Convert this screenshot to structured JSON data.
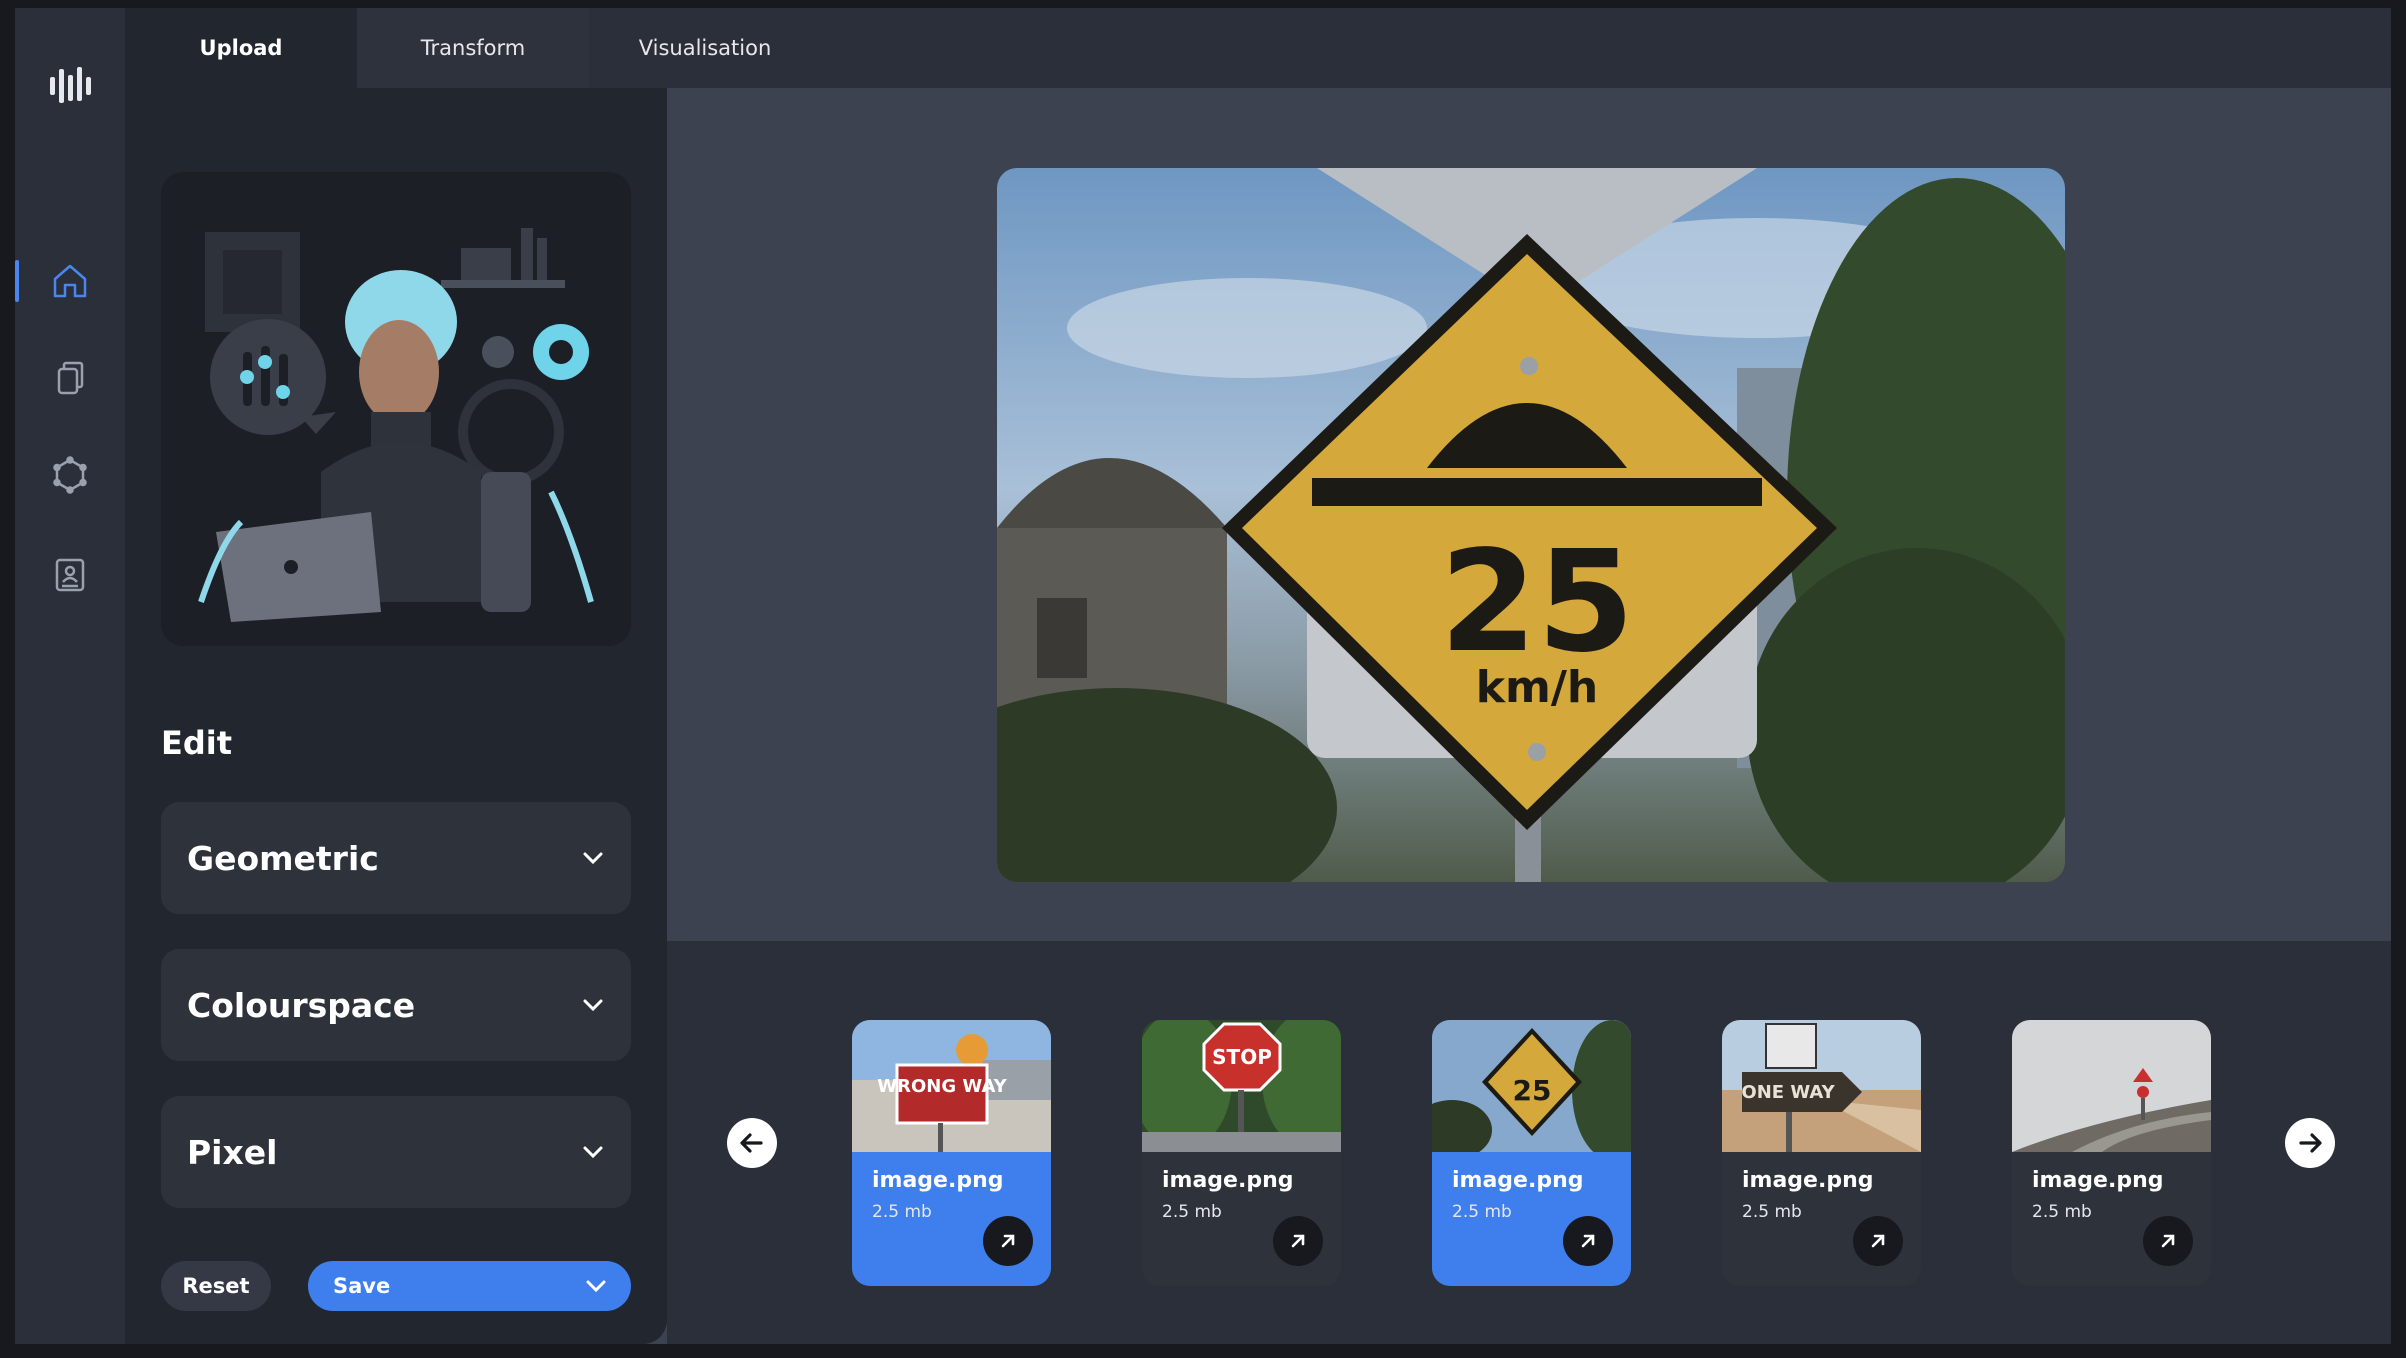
{
  "tabs": [
    {
      "label": "Upload"
    },
    {
      "label": "Transform"
    },
    {
      "label": "Visualisation"
    }
  ],
  "rail": {
    "items": [
      {
        "icon": "home-icon",
        "active": true
      },
      {
        "icon": "copy-icon"
      },
      {
        "icon": "hexagon-icon"
      },
      {
        "icon": "report-icon"
      }
    ]
  },
  "panel": {
    "edit_title": "Edit",
    "sections": [
      {
        "label": "Geometric"
      },
      {
        "label": "Colourspace"
      },
      {
        "label": "Pixel"
      }
    ],
    "reset_label": "Reset",
    "save_label": "Save"
  },
  "preview": {
    "sign_number": "25",
    "sign_unit": "km/h"
  },
  "gallery": [
    {
      "name": "image.png",
      "size": "2.5 mb",
      "selected": true,
      "sign": "WRONG WAY"
    },
    {
      "name": "image.png",
      "size": "2.5 mb",
      "selected": false,
      "sign": "STOP"
    },
    {
      "name": "image.png",
      "size": "2.5 mb",
      "selected": true,
      "sign": "25"
    },
    {
      "name": "image.png",
      "size": "2.5 mb",
      "selected": false,
      "sign": "ONE WAY"
    },
    {
      "name": "image.png",
      "size": "2.5 mb",
      "selected": false,
      "sign": ""
    }
  ],
  "colors": {
    "accent": "#3e7fed",
    "rail_bg": "#2b2f39",
    "panel_bg": "#22262e",
    "canvas_bg": "#3d4251"
  }
}
